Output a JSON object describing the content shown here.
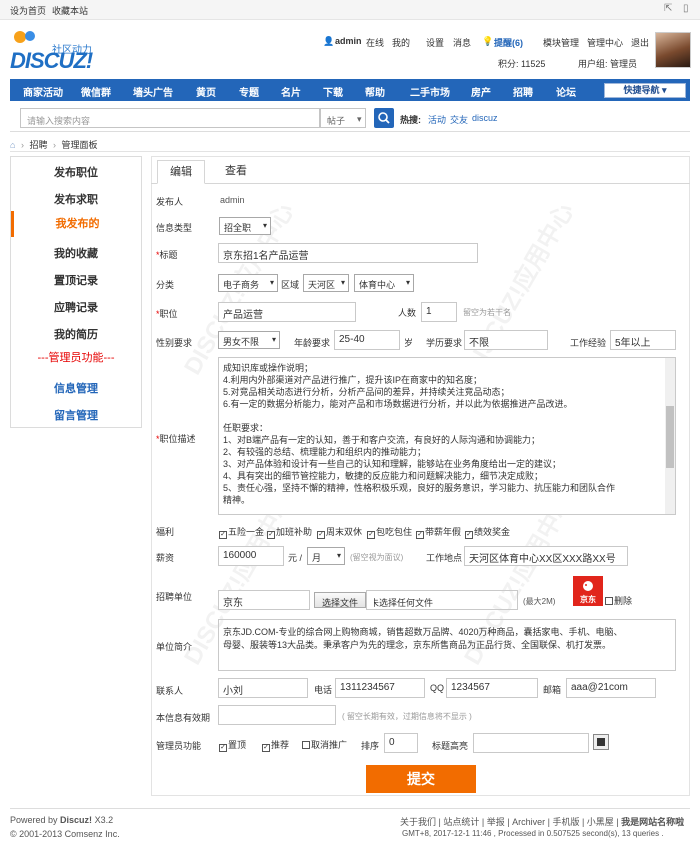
{
  "topbar": {
    "set_home": "设为首页",
    "bookmark": "收藏本站"
  },
  "brand": {
    "logo_cn": "社区动力",
    "logo_en": "DISCUZ!"
  },
  "user": {
    "name": "admin",
    "status": "在线",
    "mine": "我的",
    "settings": "设置",
    "messages": "消息",
    "reminders": "提醒(6)",
    "module_admin": "模块管理",
    "admin_center": "管理中心",
    "logout": "退出",
    "points": "积分: 11525",
    "group": "用户组: 管理员"
  },
  "nav": {
    "items": [
      "商家活动",
      "微信群",
      "墙头广告",
      "黄页",
      "专题",
      "名片",
      "下载",
      "帮助",
      "二手市场",
      "房产",
      "招聘",
      "论坛"
    ],
    "quick": "快捷导航"
  },
  "search": {
    "placeholder": "请输入搜索内容",
    "type": "帖子",
    "hot_label": "热搜:",
    "hot": [
      "活动",
      "交友",
      "discuz"
    ]
  },
  "breadcrumb": {
    "items": [
      "招聘",
      "管理面板"
    ]
  },
  "sidebar": {
    "items": [
      "发布职位",
      "发布求职",
      "我发布的",
      "我的收藏",
      "置顶记录",
      "应聘记录",
      "我的简历",
      "---管理员功能---",
      "信息管理",
      "留言管理"
    ]
  },
  "tabs": [
    "编辑",
    "查看"
  ],
  "form": {
    "publisher_label": "发布人",
    "publisher": "admin",
    "type_label": "信息类型",
    "type": "招全职",
    "title_label": "标题",
    "title": "京东招1名产品运营",
    "category_label": "分类",
    "category": "电子商务",
    "area_label": "区域",
    "area1": "天河区",
    "area2": "体育中心",
    "position_label": "职位",
    "position": "产品运营",
    "headcount_label": "人数",
    "headcount": "1",
    "headcount_hint": "留空为若干名",
    "gender_label": "性别要求",
    "gender": "男女不限",
    "age_label": "年龄要求",
    "age": "25-40",
    "age_unit": "岁",
    "edu_label": "学历要求",
    "edu": "不限",
    "exp_label": "工作经验",
    "exp": "5年以上",
    "desc_label": "职位描述",
    "desc_lines": [
      "成知识库或操作说明；",
      "4.利用内外部渠道对产品进行推广，提升该IP在商家中的知名度；",
      "5.对竞品相关动态进行分析，分析产品间的差异，并持续关注竞品动态；",
      "6.有一定的数据分析能力，能对产品和市场数据进行分析，并以此为依据推进产品改进。",
      "",
      "任职要求：",
      "1、对B端产品有一定的认知，善于和客户交流，有良好的人际沟通和协调能力；",
      "2、有较强的总结、梳理能力和组织内的推动能力；",
      "3、对产品体验和设计有一些自己的认知和理解，能够站在业务角度给出一定的建议；",
      "4、具有突出的细节管控能力，敏捷的反应能力和问题解决能力，细节决定成败；",
      "5、责任心强，坚持不懈的精神，性格积极乐观，良好的服务意识，学习能力、抗压能力和团队合作",
      "精神。"
    ],
    "welfare_label": "福利",
    "welfare": [
      "五险一金",
      "加班补助",
      "周末双休",
      "包吃包住",
      "带薪年假",
      "绩效奖金"
    ],
    "salary_label": "薪资",
    "salary": "160000",
    "salary_unit": "元 /",
    "salary_period": "月",
    "salary_hint": "(留空视为面议)",
    "location_label": "工作地点",
    "location": "天河区体育中心XX区XXX路XX号",
    "company_label": "招聘单位",
    "company": "京东",
    "file_button": "选择文件",
    "file_status": "未选择任何文件",
    "file_hint": "(最大2M)",
    "delete_label": "删除",
    "company_logo": "京东",
    "intro_label": "单位简介",
    "intro_lines": [
      "京东JD.COM-专业的综合网上购物商城，销售超数万品牌、4020万种商品，囊括家电、手机、电脑、",
      "母婴、服装等13大品类。秉承客户为先的理念，京东所售商品为正品行货、全国联保、机打发票。"
    ],
    "contact_label": "联系人",
    "contact": "小刘",
    "phone_label": "电话",
    "phone": "1311234567",
    "qq_label": "QQ",
    "qq": "1234567",
    "email_label": "邮箱",
    "email": "aaa@21com",
    "expire_label": "本信息有效期",
    "expire_hint": "( 留空长期有效，过期信息将不显示 )",
    "admin_label": "管理员功能",
    "admin_opts": [
      "置顶",
      "推荐",
      "取消推广"
    ],
    "order_label": "排序",
    "order": "0",
    "highlight_label": "标题高亮",
    "submit": "提交"
  },
  "footer": {
    "powered": "Powered by",
    "product": "Discuz!",
    "version": "X3.2",
    "copyright": "© 2001-2013 Comsenz Inc.",
    "links": [
      "关于我们",
      "站点统计",
      "举报",
      "Archiver",
      "手机版",
      "小黑屋",
      "我是网站名称啦"
    ],
    "stats": "GMT+8, 2017-12-1 11:46 , Processed in 0.507525 second(s), 13 queries ."
  },
  "colors": {
    "nav": "#2366b9",
    "accent": "#f26c00",
    "required": "#e60000"
  }
}
